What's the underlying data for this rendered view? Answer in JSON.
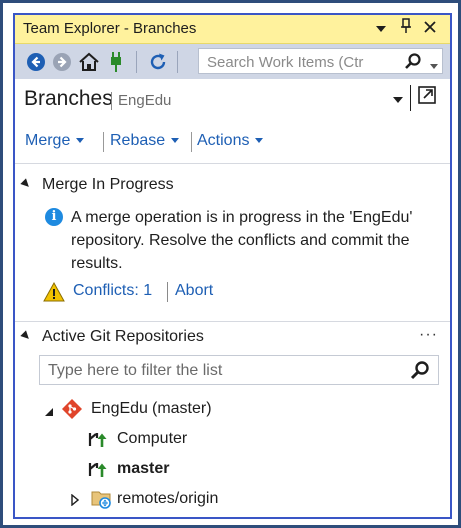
{
  "window": {
    "title": "Team Explorer - Branches",
    "title_buttons": [
      "pin-dropdown",
      "pin",
      "close"
    ]
  },
  "toolbar": {
    "search_placeholder": "Search Work Items (Ctr"
  },
  "header": {
    "page_title": "Branches",
    "repo_name": "EngEdu"
  },
  "nav": {
    "merge": "Merge",
    "rebase": "Rebase",
    "actions": "Actions"
  },
  "merge_section": {
    "title": "Merge In Progress",
    "message": "A merge operation is in progress in the 'EngEdu' repository. Resolve the conflicts and commit the results.",
    "conflicts_label": "Conflicts: 1",
    "abort_label": "Abort"
  },
  "repos_section": {
    "title": "Active Git Repositories",
    "more": "···",
    "filter_placeholder": "Type here to filter the list"
  },
  "tree": {
    "repo": {
      "name": "EngEdu",
      "branch_note": "(master)"
    },
    "branches": [
      {
        "label": "Computer",
        "bold": false
      },
      {
        "label": "master",
        "bold": true
      }
    ],
    "remotes": {
      "label": "remotes/origin"
    }
  },
  "colors": {
    "title_bar": "#fff29d",
    "toolbar": "#cfd6e5",
    "link": "#1e5fb4",
    "frame": "#3a56c6",
    "info": "#1e8ae0",
    "warning": "#f2c200",
    "git_red": "#e0452b"
  }
}
